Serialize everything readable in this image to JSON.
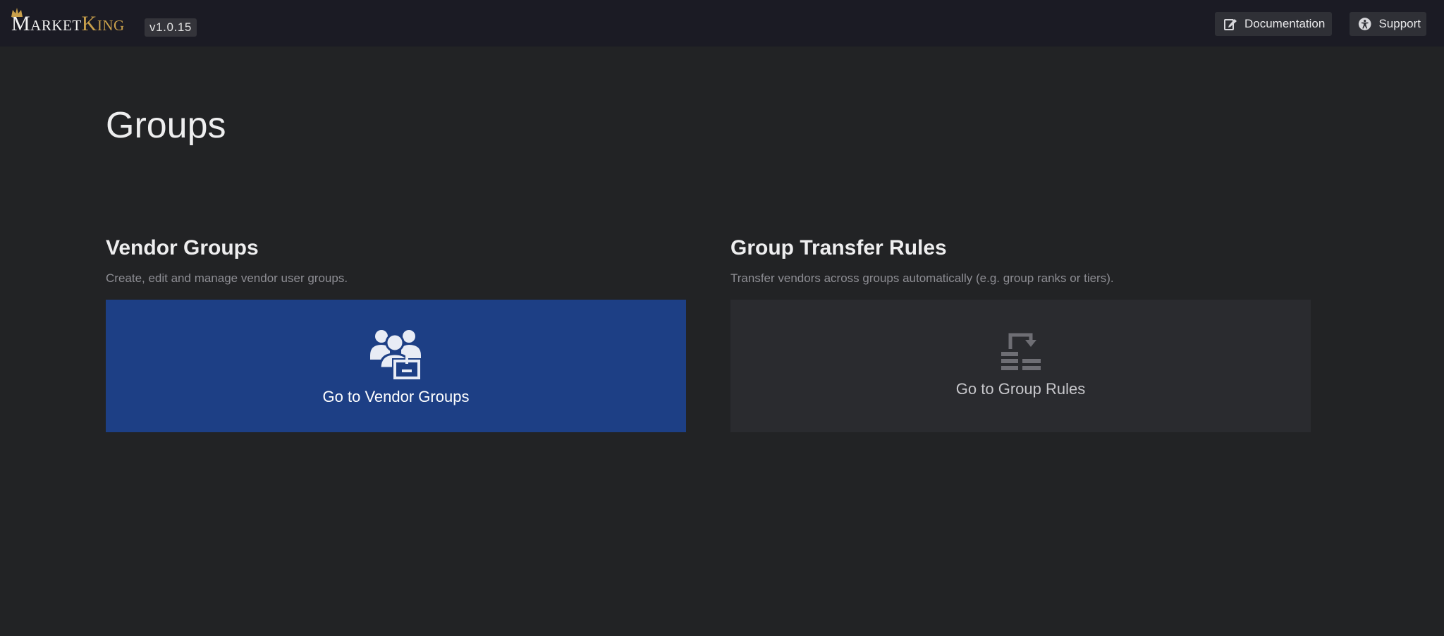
{
  "header": {
    "logo": {
      "part1": "Market",
      "part2": "King"
    },
    "version": "v1.0.15",
    "documentation_label": "Documentation",
    "support_label": "Support"
  },
  "page": {
    "title": "Groups"
  },
  "sections": [
    {
      "title": "Vendor Groups",
      "description": "Create, edit and manage vendor user groups.",
      "card_label": "Go to Vendor Groups",
      "icon": "users-group-icon",
      "color": "#1d3f85"
    },
    {
      "title": "Group Transfer Rules",
      "description": "Transfer vendors across groups automatically (e.g. group ranks or tiers).",
      "card_label": "Go to Group Rules",
      "icon": "transfer-rules-icon",
      "color": "#2a2b2f"
    }
  ],
  "colors": {
    "background": "#222325",
    "topbar": "#1b1b24",
    "accent_gold": "#c9a04b"
  }
}
